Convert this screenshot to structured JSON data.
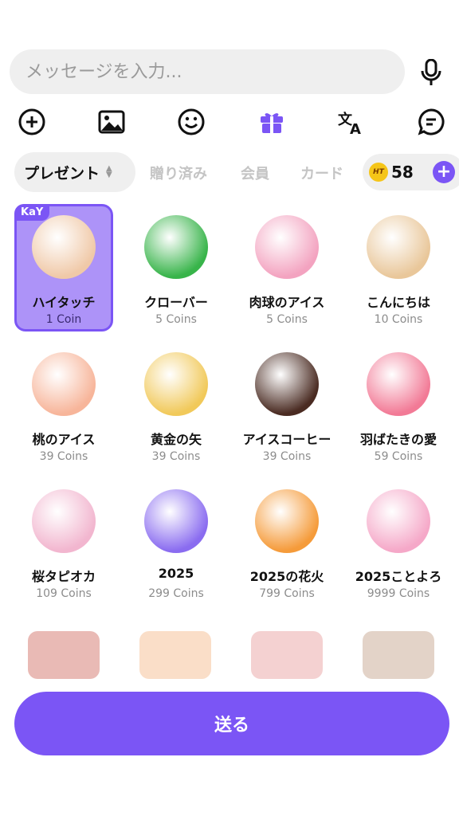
{
  "message": {
    "placeholder": "メッセージを入力..."
  },
  "icons": {
    "mic": "microphone-icon",
    "toolbar": [
      "plus-circle-icon",
      "image-icon",
      "emoji-icon",
      "gift-icon",
      "translate-icon",
      "chat-icon"
    ]
  },
  "tabs": {
    "active": "プレゼント",
    "items": [
      "贈り済み",
      "会員",
      "カード"
    ]
  },
  "wallet": {
    "badge": "HT",
    "coins": "58",
    "add_label": "+"
  },
  "gifts": [
    {
      "name": "ハイタッチ",
      "price": "1 Coin",
      "badge": "KaY",
      "selected": true,
      "color": "#f0c9a8"
    },
    {
      "name": "クローバー",
      "price": "5 Coins",
      "color": "#38b44a"
    },
    {
      "name": "肉球のアイス",
      "price": "5 Coins",
      "color": "#f3a3c0"
    },
    {
      "name": "こんにちは",
      "price": "10 Coins",
      "color": "#e9c79a"
    },
    {
      "name": "桃のアイス",
      "price": "39 Coins",
      "color": "#f7b59a"
    },
    {
      "name": "黄金の矢",
      "price": "39 Coins",
      "color": "#f1c95a"
    },
    {
      "name": "アイスコーヒー",
      "price": "39 Coins",
      "color": "#4a2b22"
    },
    {
      "name": "羽ばたきの愛",
      "price": "59 Coins",
      "color": "#f27a96"
    },
    {
      "name": "桜タピオカ",
      "price": "109 Coins",
      "color": "#f2b6cf"
    },
    {
      "name": "2025",
      "price": "299 Coins",
      "color": "#8a6cf0"
    },
    {
      "name": "2025の花火",
      "price": "799 Coins",
      "color": "#f59b3a"
    },
    {
      "name": "2025ことよろ",
      "price": "9999 Coins",
      "color": "#f5a8c8"
    }
  ],
  "faded_colors": [
    "#c0392b",
    "#f0a060",
    "#e07a7a",
    "#b08060"
  ],
  "send": {
    "label": "送る"
  },
  "colors": {
    "accent": "#7b55f5"
  }
}
